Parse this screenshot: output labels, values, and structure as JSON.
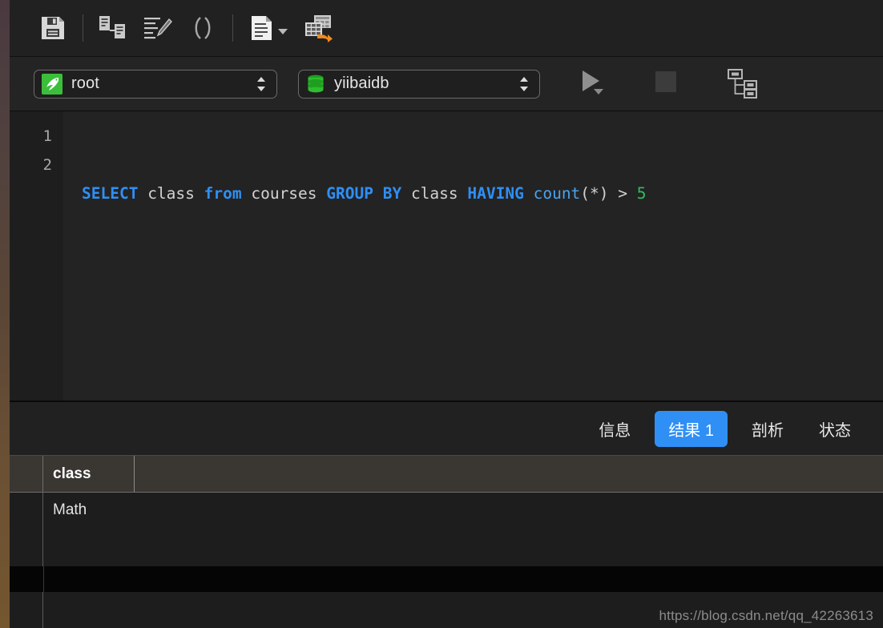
{
  "toolbar": {
    "buttons": [
      {
        "name": "save-icon",
        "label": "保存"
      },
      {
        "name": "connection-tree-icon",
        "label": "表结构"
      },
      {
        "name": "beautify-sql-icon",
        "label": "美化 SQL"
      },
      {
        "name": "parentheses-icon",
        "label": "括号"
      },
      {
        "name": "document-icon",
        "label": "文档"
      },
      {
        "name": "export-table-icon",
        "label": "导出结果"
      }
    ]
  },
  "connection": {
    "user": {
      "value": "root",
      "icon": "mysql-dolphin-icon"
    },
    "database": {
      "value": "yiibaidb",
      "icon": "database-cylinder-icon"
    },
    "run_label": "运行",
    "stop_label": "停止",
    "explain_label": "解释"
  },
  "editor": {
    "line_numbers": [
      "1",
      "2"
    ],
    "query_tokens": [
      {
        "t": "SELECT",
        "c": "kw"
      },
      {
        "t": " class ",
        "c": "pl"
      },
      {
        "t": "from",
        "c": "kw"
      },
      {
        "t": " courses ",
        "c": "pl"
      },
      {
        "t": "GROUP BY",
        "c": "kw"
      },
      {
        "t": " class ",
        "c": "pl"
      },
      {
        "t": "HAVING",
        "c": "kw"
      },
      {
        "t": " ",
        "c": "pl"
      },
      {
        "t": "count",
        "c": "fn"
      },
      {
        "t": "(*) > ",
        "c": "pl"
      },
      {
        "t": "5",
        "c": "num"
      }
    ],
    "query_text": "SELECT class from courses GROUP BY class HAVING count(*) > 5"
  },
  "tabs": [
    {
      "label": "信息",
      "active": false
    },
    {
      "label": "结果 1",
      "active": true
    },
    {
      "label": "剖析",
      "active": false
    },
    {
      "label": "状态",
      "active": false
    }
  ],
  "result_grid": {
    "columns": [
      "class"
    ],
    "rows": [
      [
        "Math"
      ]
    ]
  },
  "watermark": "https://blog.csdn.net/qq_42263613",
  "colors": {
    "accent": "#2f8ff5",
    "keyword": "#2f8ff5",
    "function": "#4aa3f0",
    "number": "#2fbf5e",
    "mysql_green": "#3bbf3b",
    "export_orange": "#f08a1e",
    "window_bg": "#1d1d1d",
    "editor_bg": "#232323",
    "header_bg": "#3a3733"
  }
}
